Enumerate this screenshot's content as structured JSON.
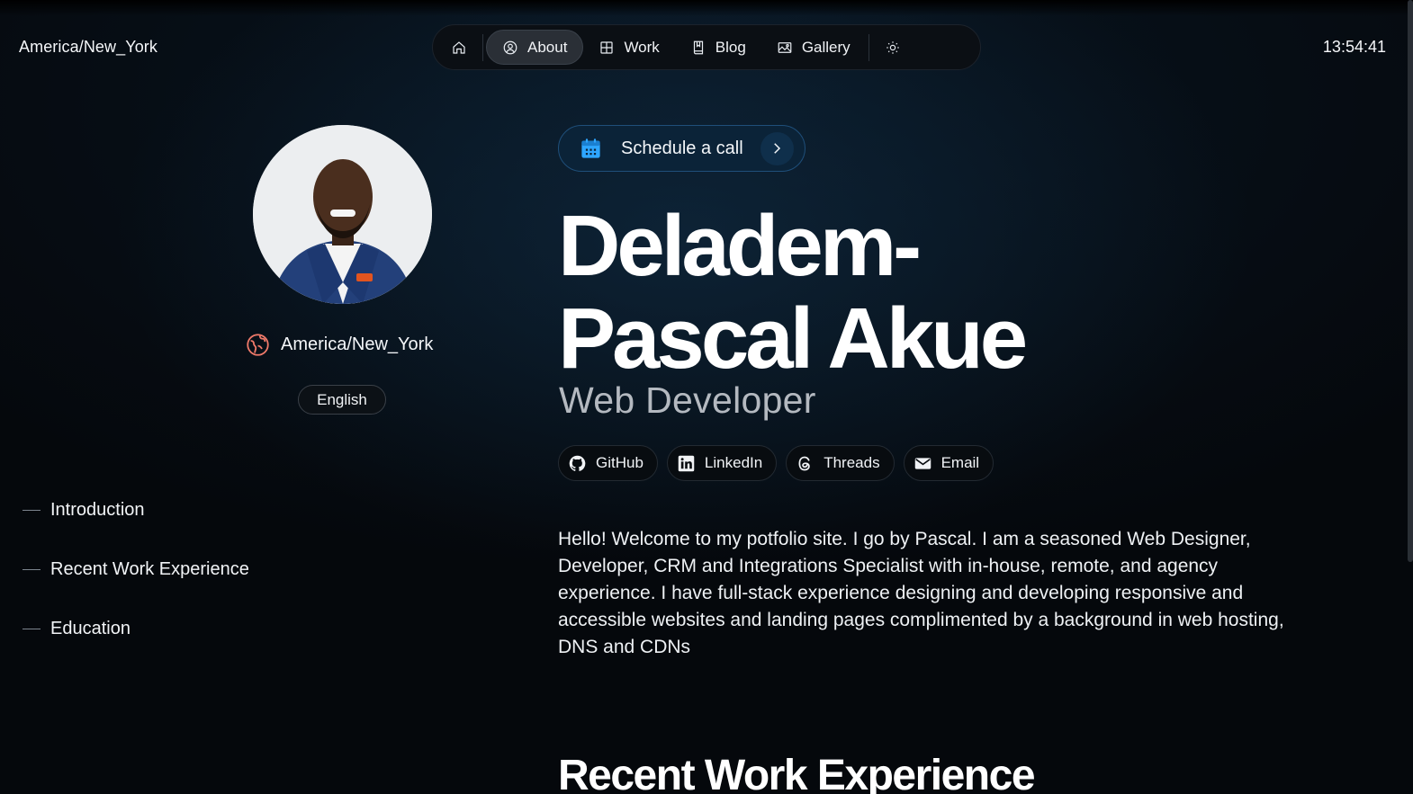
{
  "header": {
    "timezone": "America/New_York",
    "clock": "13:54:41"
  },
  "nav": {
    "items": [
      {
        "icon": "home-icon",
        "label": ""
      },
      {
        "icon": "user-circle-icon",
        "label": "About",
        "active": true
      },
      {
        "icon": "grid-icon",
        "label": "Work"
      },
      {
        "icon": "book-icon",
        "label": "Blog"
      },
      {
        "icon": "image-icon",
        "label": "Gallery"
      },
      {
        "icon": "sun-icon",
        "label": ""
      }
    ]
  },
  "profile": {
    "location": "America/New_York",
    "language": "English"
  },
  "toc": {
    "items": [
      "Introduction",
      "Recent Work Experience",
      "Education"
    ]
  },
  "hero": {
    "schedule_label": "Schedule a call",
    "name_line1": "Deladem-",
    "name_line2": "Pascal Akue",
    "role": "Web Developer",
    "socials": [
      "GitHub",
      "LinkedIn",
      "Threads",
      "Email"
    ],
    "intro": "Hello! Welcome to my potfolio site. I go by Pascal. I am a seasoned Web Designer, Developer, CRM and Integrations Specialist with in-house, remote, and agency experience. I have full-stack experience designing and developing responsive and accessible websites and landing pages complimented by a background in web hosting, DNS and CDNs",
    "next_section_title": "Recent Work Experience"
  },
  "colors": {
    "accent_blue": "#1f4f7a",
    "calendar_icon": "#2ea6ff",
    "location_icon": "#f07a6a"
  }
}
